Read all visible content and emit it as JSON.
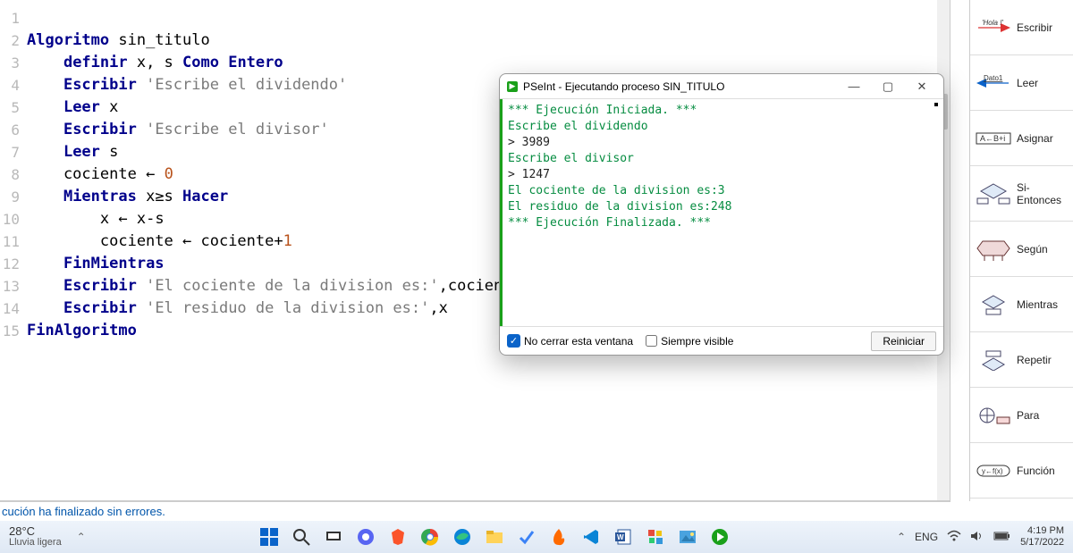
{
  "editor": {
    "lines": 15
  },
  "code": {
    "l1_kw": "Algoritmo",
    "l1_id": " sin_titulo",
    "l2_a": "    ",
    "l2_kw": "definir",
    "l2_b": " x, s ",
    "l2_kw2": "Como Entero",
    "l3_a": "    ",
    "l3_kw": "Escribir",
    "l3_s": " 'Escribe el dividendo'",
    "l4_a": "    ",
    "l4_kw": "Leer",
    "l4_b": " x",
    "l5_a": "    ",
    "l5_kw": "Escribir",
    "l5_s": " 'Escribe el divisor'",
    "l6_a": "    ",
    "l6_kw": "Leer",
    "l6_b": " s",
    "l7_a": "    cociente ",
    "l7_arrow": "←",
    "l7_b": " ",
    "l7_num": "0",
    "l8_a": "    ",
    "l8_kw": "Mientras",
    "l8_b": " x≥s ",
    "l8_kw2": "Hacer",
    "l9_a": "        x ",
    "l9_arrow": "←",
    "l9_b": " x-s",
    "l10_a": "        cociente ",
    "l10_arrow": "←",
    "l10_b": " cociente+",
    "l10_num": "1",
    "l11_a": "    ",
    "l11_kw": "FinMientras",
    "l12_a": "    ",
    "l12_kw": "Escribir",
    "l12_s": " 'El cociente de la division es:'",
    "l12_b": ",cociente",
    "l13_a": "    ",
    "l13_kw": "Escribir",
    "l13_s": " 'El residuo de la division es:'",
    "l13_b": ",x",
    "l14_kw": "FinAlgoritmo"
  },
  "panel": {
    "escribir": "Escribir",
    "leer": "Leer",
    "asignar": "Asignar",
    "si": "Si-Entonces",
    "segun": "Según",
    "mientras": "Mientras",
    "repetir": "Repetir",
    "para": "Para",
    "funcion": "Función"
  },
  "status": {
    "text": "cución ha finalizado sin errores."
  },
  "popup": {
    "title": "PSeInt - Ejecutando proceso SIN_TITULO",
    "out_start": "*** Ejecución Iniciada. ***",
    "out_l1": "Escribe el dividendo",
    "in_l1": "> 3989",
    "out_l2": "Escribe el divisor",
    "in_l2": "> 1247",
    "out_l3": "El cociente de la division es:3",
    "out_l4": "El residuo de la division es:248",
    "out_end": "*** Ejecución Finalizada. ***",
    "chk1": "No cerrar esta ventana",
    "chk2": "Siempre visible",
    "btn": "Reiniciar"
  },
  "taskbar": {
    "temp": "28°C",
    "cond": "Lluvia ligera",
    "lang": "ENG",
    "time": "4:19 PM",
    "date": "5/17/2022"
  }
}
